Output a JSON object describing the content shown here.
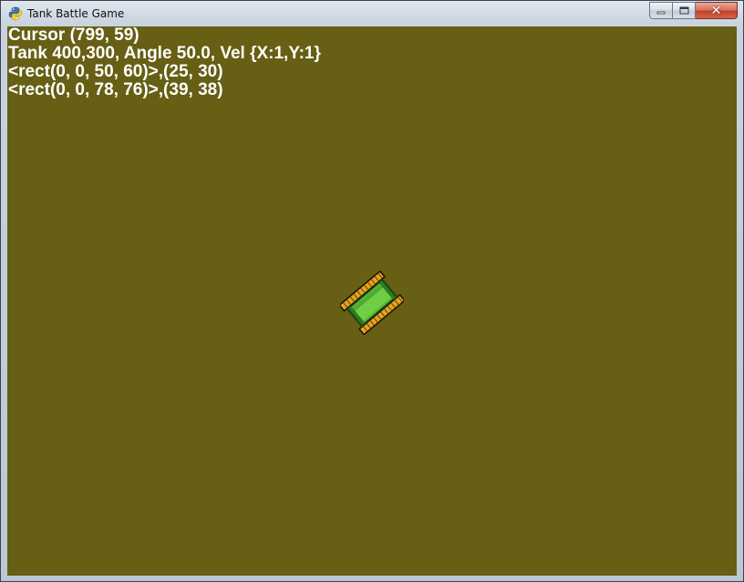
{
  "window": {
    "title": "Tank Battle Game",
    "icon": "python-icon",
    "buttons": {
      "minimize": "minimize-icon",
      "maximize": "maximize-icon",
      "close": "close-icon"
    }
  },
  "game": {
    "background_color": "#665f14",
    "hud": {
      "cursor_line": "Cursor (799, 59)",
      "tank_line": "Tank 400,300, Angle 50.0, Vel {X:1,Y:1}",
      "rect_line_1": "<rect(0, 0, 50, 60)>,(25, 30)",
      "rect_line_2": "<rect(0, 0, 78, 76)>,(39, 38)"
    },
    "tank": {
      "angle": 50.0,
      "body_color": "#52b832",
      "track_color": "#e0a020"
    }
  }
}
